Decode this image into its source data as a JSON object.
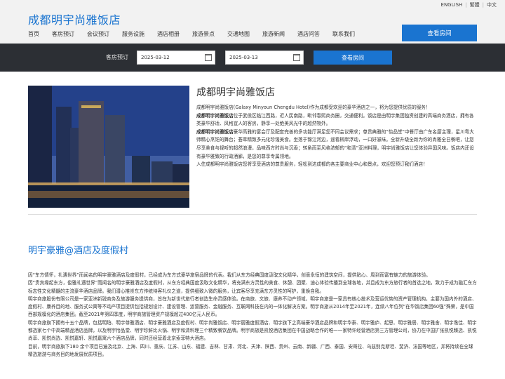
{
  "lang": {
    "en": "ENGLISH",
    "tc": "繁體",
    "sc": "中文"
  },
  "header": {
    "site_title": "成都明宇尚雅饭店",
    "nav": [
      "首页",
      "客房预订",
      "会议预订",
      "服务设施",
      "酒店相册",
      "旅游景点",
      "交通地图",
      "旅游新闻",
      "酒店问答",
      "联系我们"
    ],
    "book_button": "查看房间"
  },
  "booking": {
    "label": "客房预订",
    "checkin": "2025-03-12",
    "checkout": "2025-03-13",
    "button": "查看房间"
  },
  "hotel": {
    "title": "成都明宇尚雅饭店",
    "p1": "成都明宇尚雅饭店(Galaxy Minyoun Chengdu Hotel)作为成都受欢迎的豪华酒店之一，将为您提供优质的服务！",
    "p2_bold": "成都明宇尚雅饭店",
    "p2": "位于武侯区临江西路，近人民南路，毗邻春熙商务圈，交通便利。饭店是由明宇集团独资创建的高端商务酒店，拥有各类豪华舒适、风格宜人的客房，静享一处绝美风光中的超然物外。",
    "p3_bold": "成都明宇尚雅饭店",
    "p3": "豪华高雅的宴会厅及配套完善的多功能厅满足您不同会议需求；尊贵典雅的“怡品堂”中餐厅由广东名厨主理，星川粤大师精心烹饪的舞台；荟萃精致多元化珍馐美食。坐落于锦江河边，遥看柳岸浮动，一口好滋味。全新升级全新为你的尚雅全日餐吧，让您尽享美食与视听的超然浪漫，品味西方时尚与沉香；转角而至风格浓郁的“和清”亚洲料理，明宇尚雅饭店让您体验异国风味。饭店内还设有豪华雅致的行政酒廊，是您的尊享专属领地。",
    "p4": "入住成都明宇尚雅饭店您将享受酒店的尊贵服务，轻松到达成都的各主要商业中心和景点，欢迎您预订我们酒店！"
  },
  "brand": {
    "title": "明宇豪雅@酒店及度假村",
    "paragraphs": [
      "因“东方情怀，礼遇世界”而闻名的明宇豪雅酒店及度假村，已经成为东方式豪华旅宿品牌的代表。我们从东方经典国度汲取文化精华，创意永恒的建筑空间，提供贴心、周到而富有魅力的旅游体验。",
      "因“贵宾缘起东方，俊雅礼遇世界”而闻名的明宇豪雅酒店及度假村，从东方经典国度汲取文化精华，将充满东方灵性的美食、休憩、团聚、迪心体验传播到全球各地，并且成为东方旅行者的首选之地，致力于成为融汇东方标志性文化精髓的主流豪华酒店品牌。我们潜心推崇东方传统待客礼仪之道，提供细致入微的服务，让宾客尽享充满东方灵性的呵护，重焕自我。",
      "明宇商旅股份有限公司是一家亚洲新锐商务及旅游服务提供商，旨在为新世代旅行者创造生命灵感体验。在商旅、文旅、康养不动产领域，明宇商旅是一家具有核心技术及营运优势的资产管理机构，主要为国内外的酒店、度假村、康养目的地、服务式公寓等不动产项目提供包括规划设计、建设管理、运营服务、金融服务、互联网科技在内的一体化解决方案。明宇商旅从2014年至2021年，连续八年位列“在华饭店集团60强”殊荣，是中国西部规模化的酒店集团。截至2021年第四季度，明宇商旅管理资产规模超过400亿元人民币。",
      "明宇商旅旗下拥有十五个品牌，包括明珀、明宇尊雅酒店、明宇豪雅酒店及度假村、明宇尚雅饭店、明宇丽雅度假酒店、明宇旗下之高端豪华酒店品牌和明宇华泰、明宇雅庐、起思、明宇雅居、明宇雅舍、明宇逸佳、明宇都选家七个中高端精品酒店品牌，以及明宇怡品堂、明宇珍鲜比火锅、明宇和清料理三个精致餐饮品牌。明宇商旅是凯悦酒店集团在中国战略合作的唯一一家特许经营酒店第三方管理公司，协力在中国扩张凯悦臻选、凯悦尚萃、凯悦尚选、凯悦嘉轩、凯悦嘉寓六个酒店品牌，同时还经营着北京索菲特大酒店。",
      "目前，明宇商旅旗下180 余个项目已遍及北京、上海、四川、重庆、江苏、山东、福建、吉林、甘肃、河北、天津、陕西、贵州、云南、新疆、广西、泰国、安哥拉、乌兹别克斯坦、斐济、法国等地区，并将持续在全球精选旅游与商务目的地发展优质项目。"
    ]
  },
  "colors": {
    "accent": "#1a74d0",
    "bookbar": "#2c2f34"
  }
}
